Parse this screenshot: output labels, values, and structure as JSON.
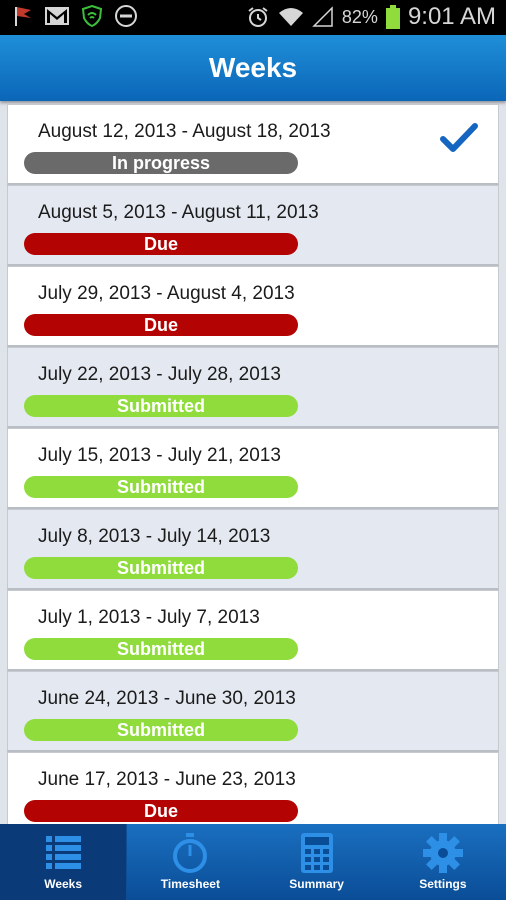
{
  "status_bar": {
    "battery": "82%",
    "time": "9:01 AM"
  },
  "header": {
    "title": "Weeks"
  },
  "weeks": [
    {
      "range": "August 12, 2013 - August 18, 2013",
      "status": "In progress",
      "kind": "progress",
      "selected": true
    },
    {
      "range": "August 5, 2013 - August 11, 2013",
      "status": "Due",
      "kind": "due",
      "selected": false
    },
    {
      "range": "July 29, 2013 - August 4, 2013",
      "status": "Due",
      "kind": "due",
      "selected": false
    },
    {
      "range": "July 22, 2013 - July 28, 2013",
      "status": "Submitted",
      "kind": "submitted",
      "selected": false
    },
    {
      "range": "July 15, 2013 - July 21, 2013",
      "status": "Submitted",
      "kind": "submitted",
      "selected": false
    },
    {
      "range": "July 8, 2013 - July 14, 2013",
      "status": "Submitted",
      "kind": "submitted",
      "selected": false
    },
    {
      "range": "July 1, 2013 - July 7, 2013",
      "status": "Submitted",
      "kind": "submitted",
      "selected": false
    },
    {
      "range": "June 24, 2013 - June 30, 2013",
      "status": "Submitted",
      "kind": "submitted",
      "selected": false
    },
    {
      "range": "June 17, 2013 - June 23, 2013",
      "status": "Due",
      "kind": "due",
      "selected": false
    }
  ],
  "nav": {
    "items": [
      {
        "label": "Weeks",
        "icon": "list-icon",
        "active": true
      },
      {
        "label": "Timesheet",
        "icon": "stopwatch-icon",
        "active": false
      },
      {
        "label": "Summary",
        "icon": "calculator-icon",
        "active": false
      },
      {
        "label": "Settings",
        "icon": "gear-icon",
        "active": false
      }
    ]
  },
  "colors": {
    "header": "#0b66b8",
    "in_progress": "#6a6a6a",
    "due": "#b40303",
    "submitted": "#8fdc3c",
    "check": "#1466c0"
  }
}
